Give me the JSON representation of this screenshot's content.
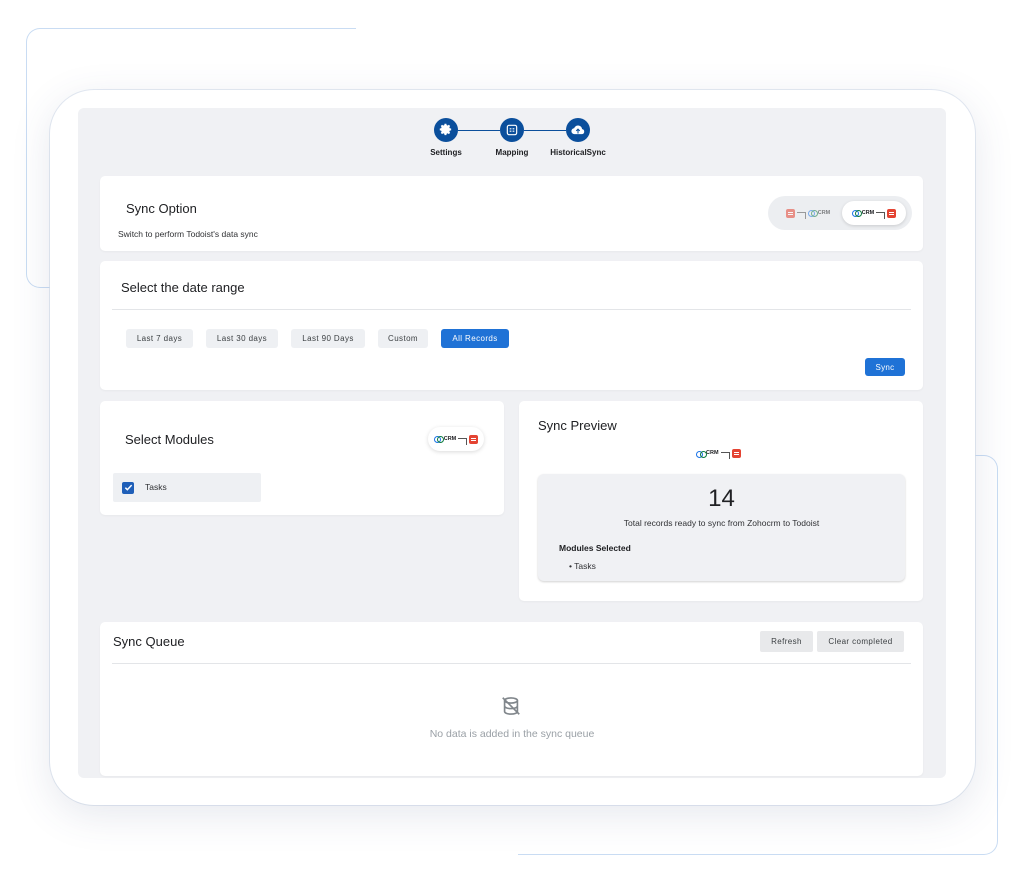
{
  "stepper": {
    "steps": [
      {
        "label": "Settings",
        "icon": "gear-icon"
      },
      {
        "label": "Mapping",
        "icon": "mapping-icon"
      },
      {
        "label": "HistoricalSync",
        "icon": "cloud-upload-icon"
      }
    ],
    "color": "#0b4f9c"
  },
  "sync_option": {
    "title": "Sync Option",
    "subtitle": "Switch to perform Todoist's data sync",
    "toggle": {
      "left_logo": "CRM",
      "right_logo": "CRM"
    }
  },
  "date_range": {
    "title": "Select the date range",
    "options": [
      "Last 7 days",
      "Last 30 days",
      "Last 90 Days",
      "Custom",
      "All Records"
    ],
    "selected": "All Records",
    "sync_label": "Sync",
    "accent": "#1f72d6"
  },
  "modules": {
    "title": "Select Modules",
    "logo": "CRM",
    "items": [
      {
        "label": "Tasks",
        "checked": true
      }
    ]
  },
  "preview": {
    "title": "Sync Preview",
    "logo": "CRM",
    "count": "14",
    "caption": "Total records ready to sync from Zohocrm to Todoist",
    "modules_title": "Modules Selected",
    "modules": [
      "• Tasks"
    ]
  },
  "queue": {
    "title": "Sync Queue",
    "refresh_label": "Refresh",
    "clear_label": "Clear completed",
    "empty_icon": "database-off-icon",
    "empty_text": "No data is added in the sync queue"
  }
}
